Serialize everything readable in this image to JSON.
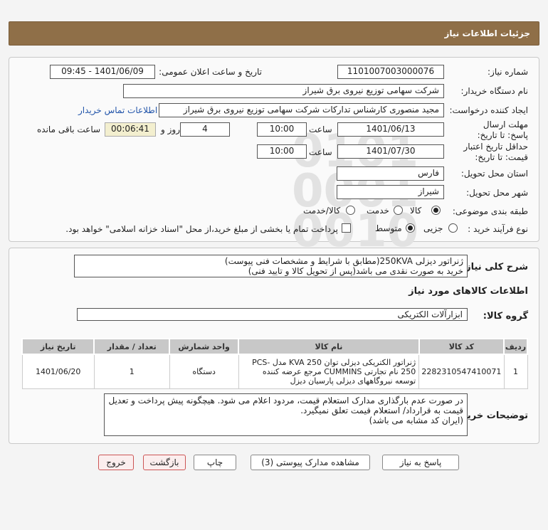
{
  "header": {
    "title": "جزئیات اطلاعات نیاز"
  },
  "form": {
    "need_number_label": "شماره نیاز:",
    "need_number": "1101007003000076",
    "announce_label": "تاریخ و ساعت اعلان عمومی:",
    "announce_value": "1401/06/09 - 09:45",
    "buyer_label": "نام دستگاه خریدار:",
    "buyer_value": "شرکت سهامی توزیع نیروی برق شیراز",
    "creator_label": "ایجاد کننده درخواست:",
    "creator_value": "مجید منصوری کارشناس تدارکات شرکت سهامی توزیع نیروی برق شیراز",
    "contact_link": "اطلاعات تماس خریدار",
    "deadline_label": "مهلت ارسال پاسخ: تا تاریخ:",
    "deadline_date": "1401/06/13",
    "time_label": "ساعت",
    "deadline_time": "10:00",
    "days_value": "4",
    "days_label": "روز و",
    "remaining_time": "00:06:41",
    "remaining_label": "ساعت باقی مانده",
    "validity_label": "حداقل تاریخ اعتبار قیمت: تا تاریخ:",
    "validity_date": "1401/07/30",
    "validity_time": "10:00",
    "province_label": "استان محل تحویل:",
    "province_value": "فارس",
    "city_label": "شهر محل تحویل:",
    "city_value": "شیراز",
    "category_label": "طبقه بندی موضوعی:",
    "category_options": [
      "کالا",
      "خدمت",
      "کالا/خدمت"
    ],
    "process_label": "نوع فرآیند خرید :",
    "process_options": [
      "جزیی",
      "متوسط"
    ],
    "payment_note": "پرداخت تمام یا بخشی از مبلغ خرید،از محل \"اسناد خزانه اسلامی\" خواهد بود."
  },
  "description": {
    "label": "شرح کلی نیاز:",
    "line1": "ژنراتور دیزلی 250KVA(مطابق با شرایط و مشخصات فنی پیوست)",
    "line2": "خرید به صورت نقدی می باشد(پس از تحویل کالا و تایید فنی)"
  },
  "goods": {
    "section_title": "اطلاعات کالاهای مورد نیاز",
    "group_label": "گروه کالا:",
    "group_value": "ابزارآلات الکتریکی",
    "columns": [
      "ردیف",
      "کد کالا",
      "نام کالا",
      "واحد شمارش",
      "تعداد / مقدار",
      "تاریخ نیاز"
    ],
    "rows": [
      {
        "row": "1",
        "code": "2282310547410071",
        "name": "ژنراتور الکتریکی دیزلی توان 250 KVA مدل PCS-250 نام تجارتی CUMMINS مرجع عرضه کننده توسعه نیروگاههای دیزلی پارسیان دیزل",
        "unit": "دستگاه",
        "qty": "1",
        "date": "1401/06/20"
      }
    ]
  },
  "buyer_notes": {
    "label": "توضیحات خریدار:",
    "line1": "در صورت عدم بارگذاری مدارک استعلام قیمت، مردود اعلام می شود. هیچگونه پیش پرداخت و تعدیل",
    "line2": "قیمت به قرارداد/ استعلام قیمت تعلق نمیگیرد.",
    "line3": "(ایران کد مشابه می باشد)"
  },
  "buttons": {
    "reply": "پاسخ به نیاز",
    "attachments": "مشاهده مدارک پیوستی (3)",
    "print": "چاپ",
    "back": "بازگشت",
    "exit": "خروج"
  }
}
